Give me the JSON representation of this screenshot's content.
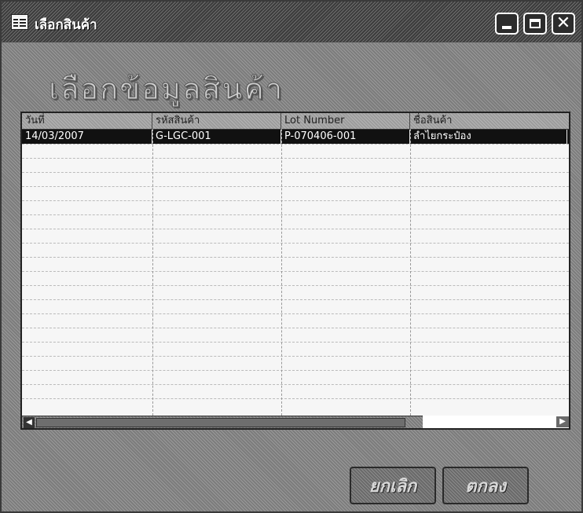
{
  "window": {
    "title": "เลือกสินค้า"
  },
  "heading": "เลือกข้อมูลสินค้า",
  "table": {
    "columns": [
      "วันที่",
      "รหัสสินค้า",
      "Lot Number",
      "ชื่อสินค้า"
    ],
    "rows": [
      {
        "date": "14/03/2007",
        "code": "G-LGC-001",
        "lot": "P-070406-001",
        "name": "ลำไยกระป๋อง"
      }
    ]
  },
  "buttons": {
    "cancel": "ยกเลิก",
    "ok": "ตกลง"
  }
}
